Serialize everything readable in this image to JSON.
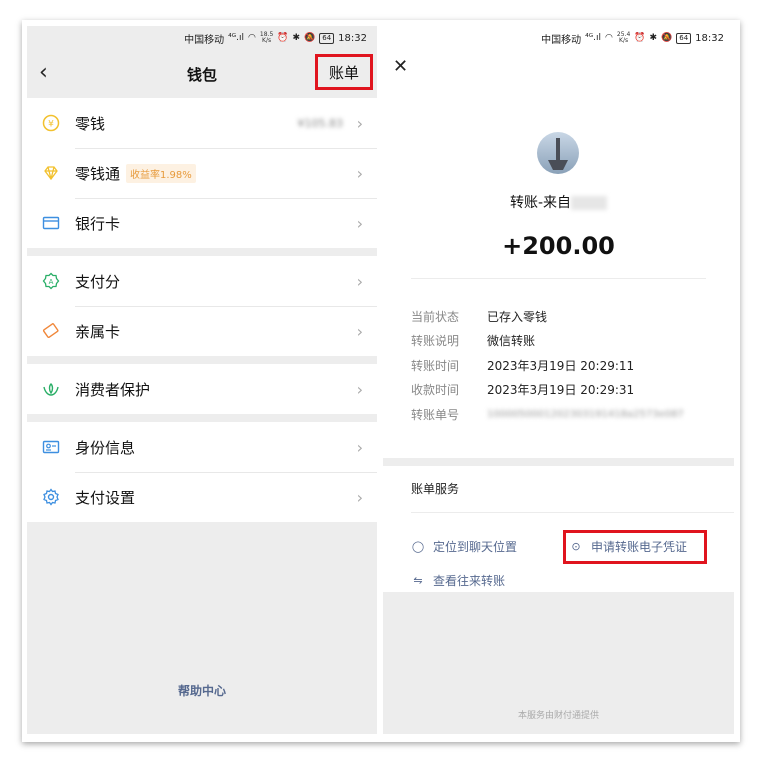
{
  "left": {
    "status": {
      "carrier": "中国移动",
      "signal": "⁴ᴳ.ıl",
      "speed_num": "18.5",
      "speed_unit": "K/s",
      "battery": "64",
      "time": "18:32"
    },
    "nav": {
      "back": "‹",
      "title": "钱包",
      "bill": "账单"
    },
    "groups": [
      [
        {
          "label": "零钱",
          "value": "¥105.83",
          "icon": "coin-icon",
          "color": "#f2c12e"
        },
        {
          "label": "零钱通",
          "badge": "收益率1.98%",
          "icon": "diamond-icon",
          "color": "#f2c12e"
        },
        {
          "label": "银行卡",
          "icon": "card-icon",
          "color": "#3d8fe0"
        }
      ],
      [
        {
          "label": "支付分",
          "icon": "score-icon",
          "color": "#2aae67"
        },
        {
          "label": "亲属卡",
          "icon": "family-card-icon",
          "color": "#f0873a"
        }
      ],
      [
        {
          "label": "消费者保护",
          "icon": "protect-icon",
          "color": "#2aae67"
        }
      ],
      [
        {
          "label": "身份信息",
          "icon": "id-icon",
          "color": "#3d8fe0"
        },
        {
          "label": "支付设置",
          "icon": "gear-icon",
          "color": "#3d8fe0"
        }
      ]
    ],
    "help": "帮助中心"
  },
  "right": {
    "status": {
      "carrier": "中国移动",
      "signal": "⁴ᴳ.ıl",
      "speed_num": "25.4",
      "speed_unit": "K/s",
      "battery": "64",
      "time": "18:32"
    },
    "close": "✕",
    "from_label": "转账-来自",
    "amount": "+200.00",
    "info": [
      {
        "key": "当前状态",
        "value": "已存入零钱"
      },
      {
        "key": "转账说明",
        "value": "微信转账"
      },
      {
        "key": "转账时间",
        "value": "2023年3月19日 20:29:11"
      },
      {
        "key": "收款时间",
        "value": "2023年3月19日 20:29:31"
      },
      {
        "key": "转账单号",
        "value": "1000050001202303191418a2573e087"
      }
    ],
    "services": {
      "title": "账单服务",
      "locate": "定位到聊天位置",
      "voucher": "申请转账电子凭证",
      "history": "查看往来转账"
    },
    "footer": "本服务由财付通提供"
  }
}
